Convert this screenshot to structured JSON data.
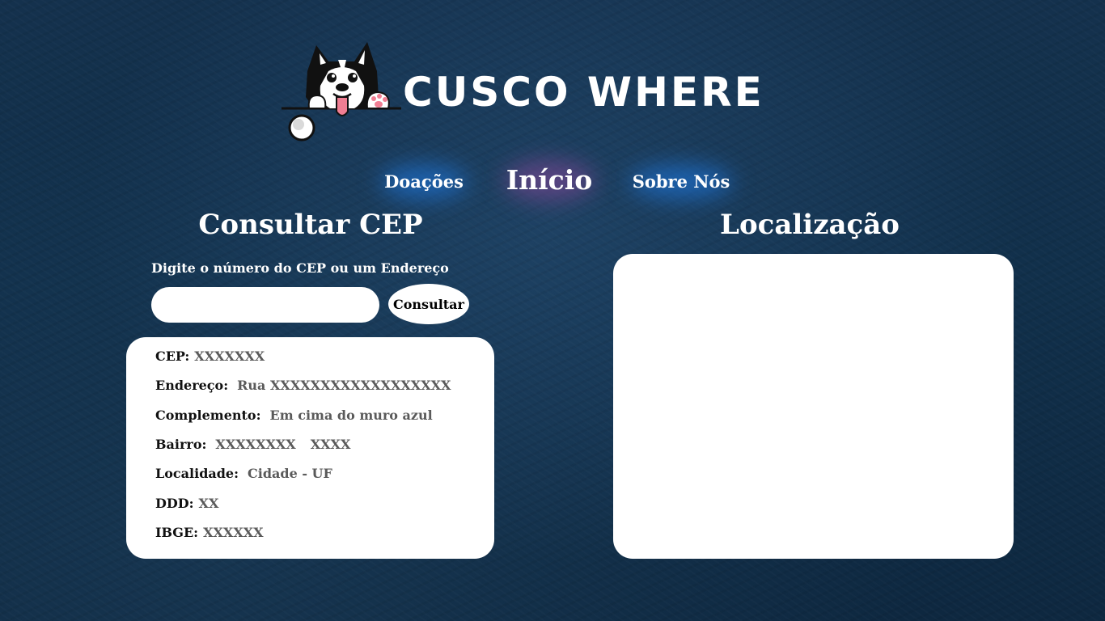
{
  "brand": {
    "name": "CUSCO WHERE",
    "logo_icon": "husky-dog-logo-icon"
  },
  "nav": {
    "items": [
      {
        "label": "Doações"
      },
      {
        "label": "Início"
      },
      {
        "label": "Sobre Nós"
      }
    ],
    "active": "Início"
  },
  "cep_section": {
    "title": "Consultar CEP",
    "prompt": "Digite o número do CEP ou um Endereço",
    "input_value": "",
    "input_placeholder": "",
    "button_label": "Consultar"
  },
  "result": {
    "cep": {
      "label": "CEP:",
      "value": "XXXXXXX"
    },
    "endereco": {
      "label": "Endereço:",
      "value": "Rua XXXXXXXXXXXXXXXXXX"
    },
    "complemento": {
      "label": "Complemento:",
      "value": "Em cima do muro azul"
    },
    "bairro": {
      "label": "Bairro:",
      "value": "XXXXXXXX",
      "value2": "XXXX"
    },
    "localidade": {
      "label": "Localidade:",
      "value": "Cidade - UF"
    },
    "ddd": {
      "label": "DDD:",
      "value": "XX"
    },
    "ibge": {
      "label": "IBGE:",
      "value": "XXXXXX"
    }
  },
  "map_section": {
    "title": "Localização"
  },
  "colors": {
    "background": "#12304b",
    "card": "#ffffff",
    "value_text": "#5a5a5a",
    "nav_glow_blue": "#1e6ec8",
    "nav_glow_purple": "#6e468c"
  }
}
